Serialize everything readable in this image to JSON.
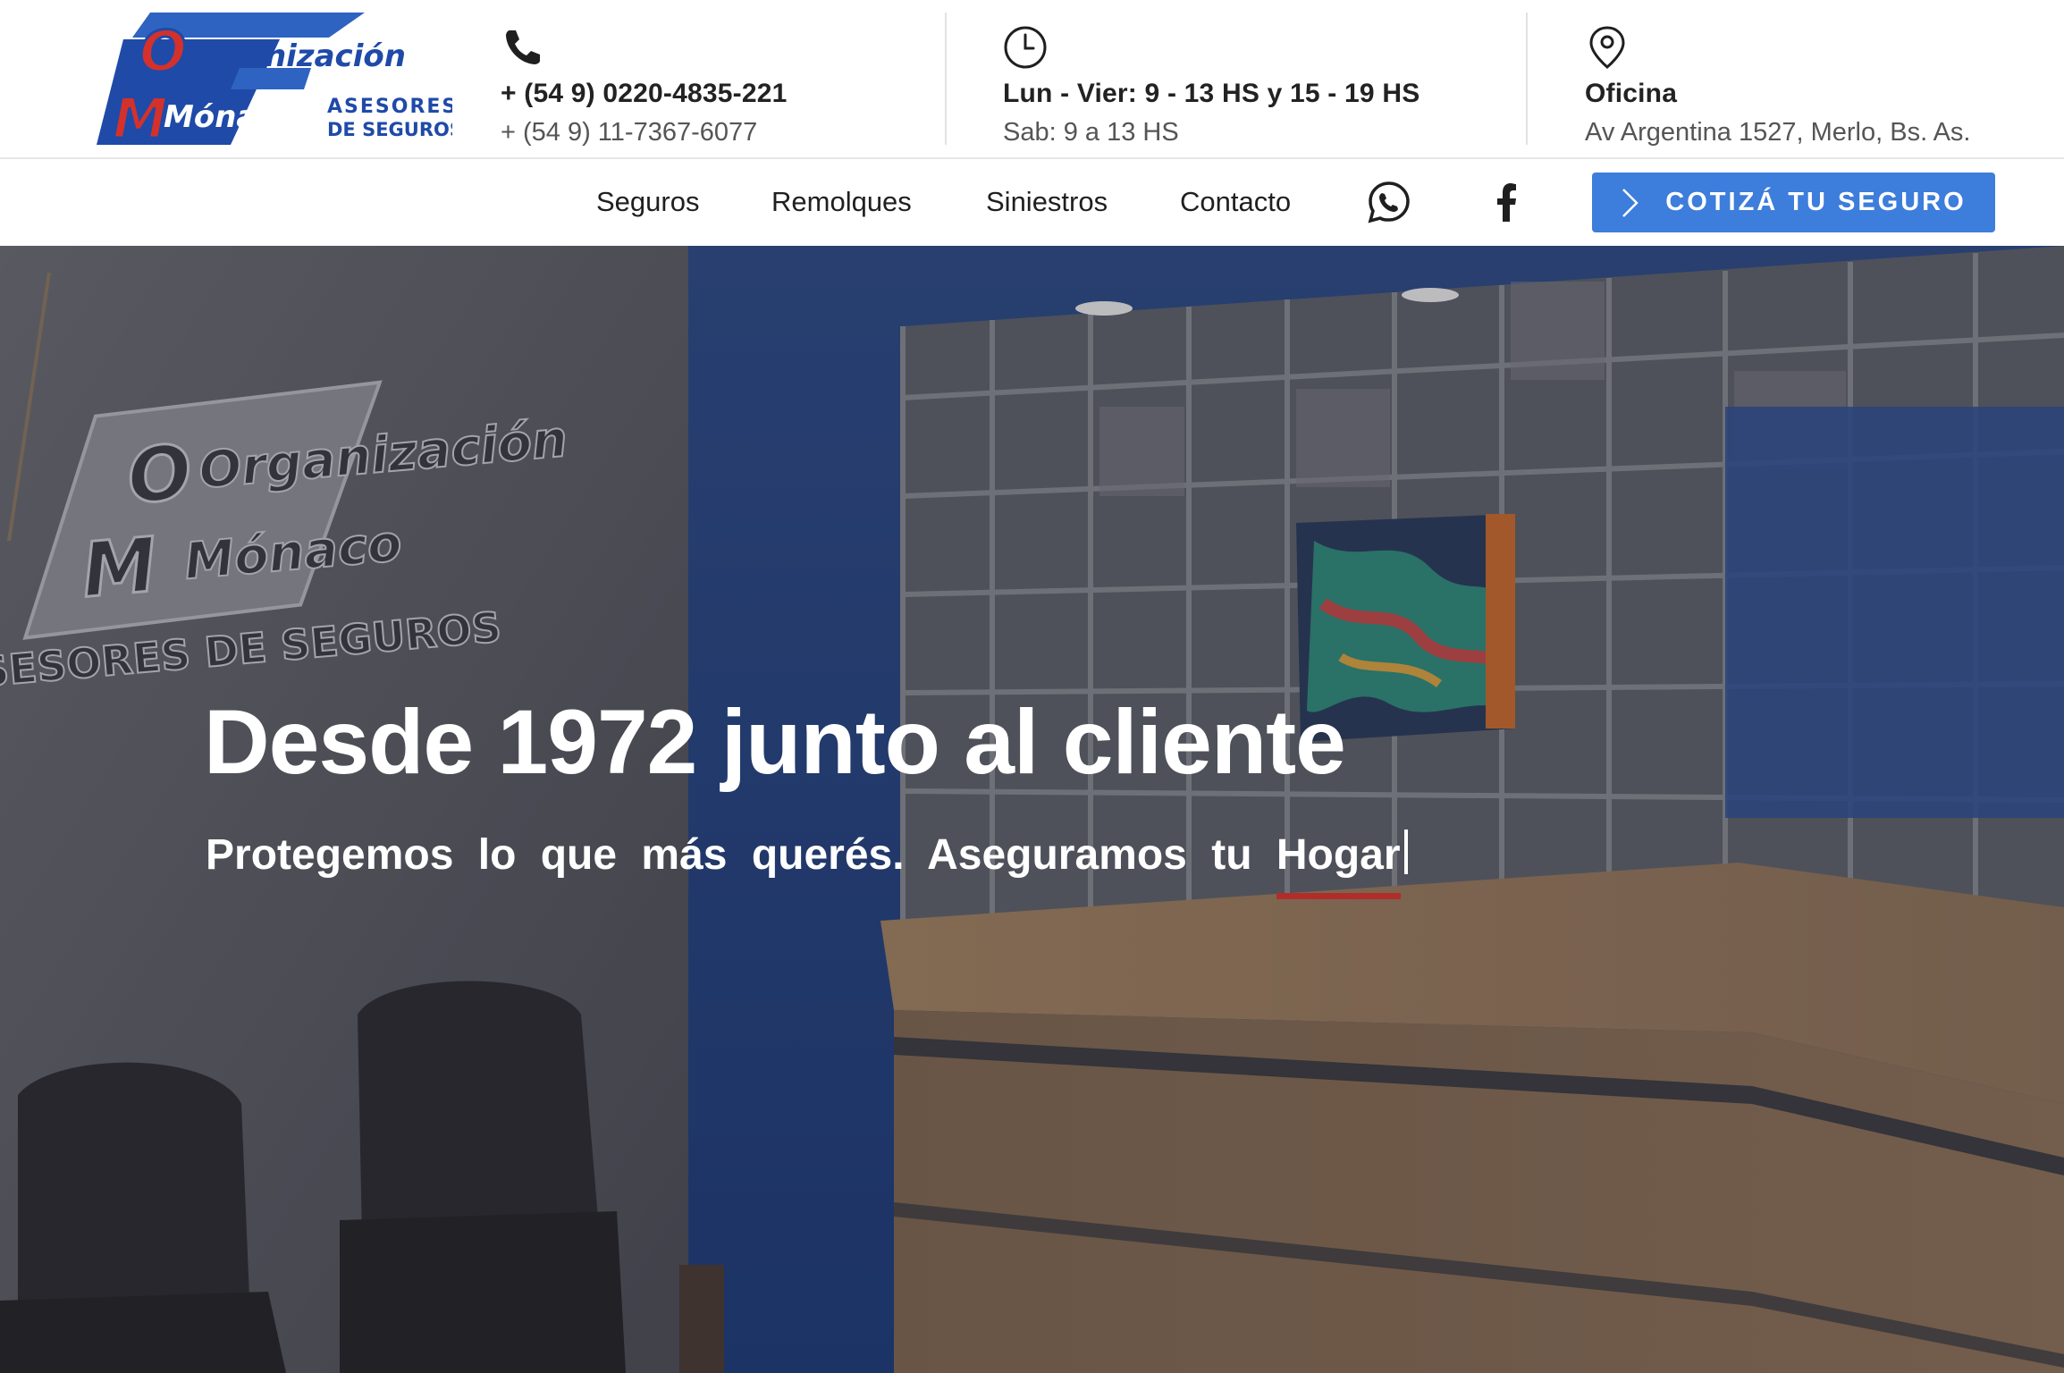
{
  "brand": {
    "logo_line1": "Organización",
    "logo_line2": "Mónaco",
    "logo_tag1": "ASESORES",
    "logo_tag2": "DE SEGUROS",
    "logo_letters": "OM",
    "colors": {
      "primary_blue": "#3d7ddb",
      "logo_blue": "#1f4aa8",
      "logo_red": "#d4312b",
      "accent_red": "#b12d2a"
    }
  },
  "contact": {
    "icon": "phone-icon",
    "phone_primary": "+ (54 9) 0220-4835-221",
    "phone_secondary": "+ (54 9) 11-7367-6077"
  },
  "hours": {
    "icon": "clock-icon",
    "weekdays": "Lun - Vier: 9 - 13 HS y 15 - 19 HS",
    "saturday": "Sab: 9 a 13 HS"
  },
  "office": {
    "icon": "location-pin-icon",
    "label": "Oficina",
    "address": "Av Argentina 1527, Merlo, Bs. As."
  },
  "nav": {
    "items": [
      "Seguros",
      "Remolques",
      "Siniestros",
      "Contacto"
    ],
    "social": [
      "whatsapp-icon",
      "facebook-icon"
    ],
    "cta_label": "COTIZÁ TU SEGURO"
  },
  "hero": {
    "title": "Desde 1972 junto al cliente",
    "subtitle_static": "Protegemos lo que más querés. Aseguramos tu",
    "subtitle_typed": "Hogar",
    "photo_sign_line1": "Organización",
    "photo_sign_line2": "Mónaco",
    "photo_sign_line3": "ASESORES DE SEGUROS"
  }
}
